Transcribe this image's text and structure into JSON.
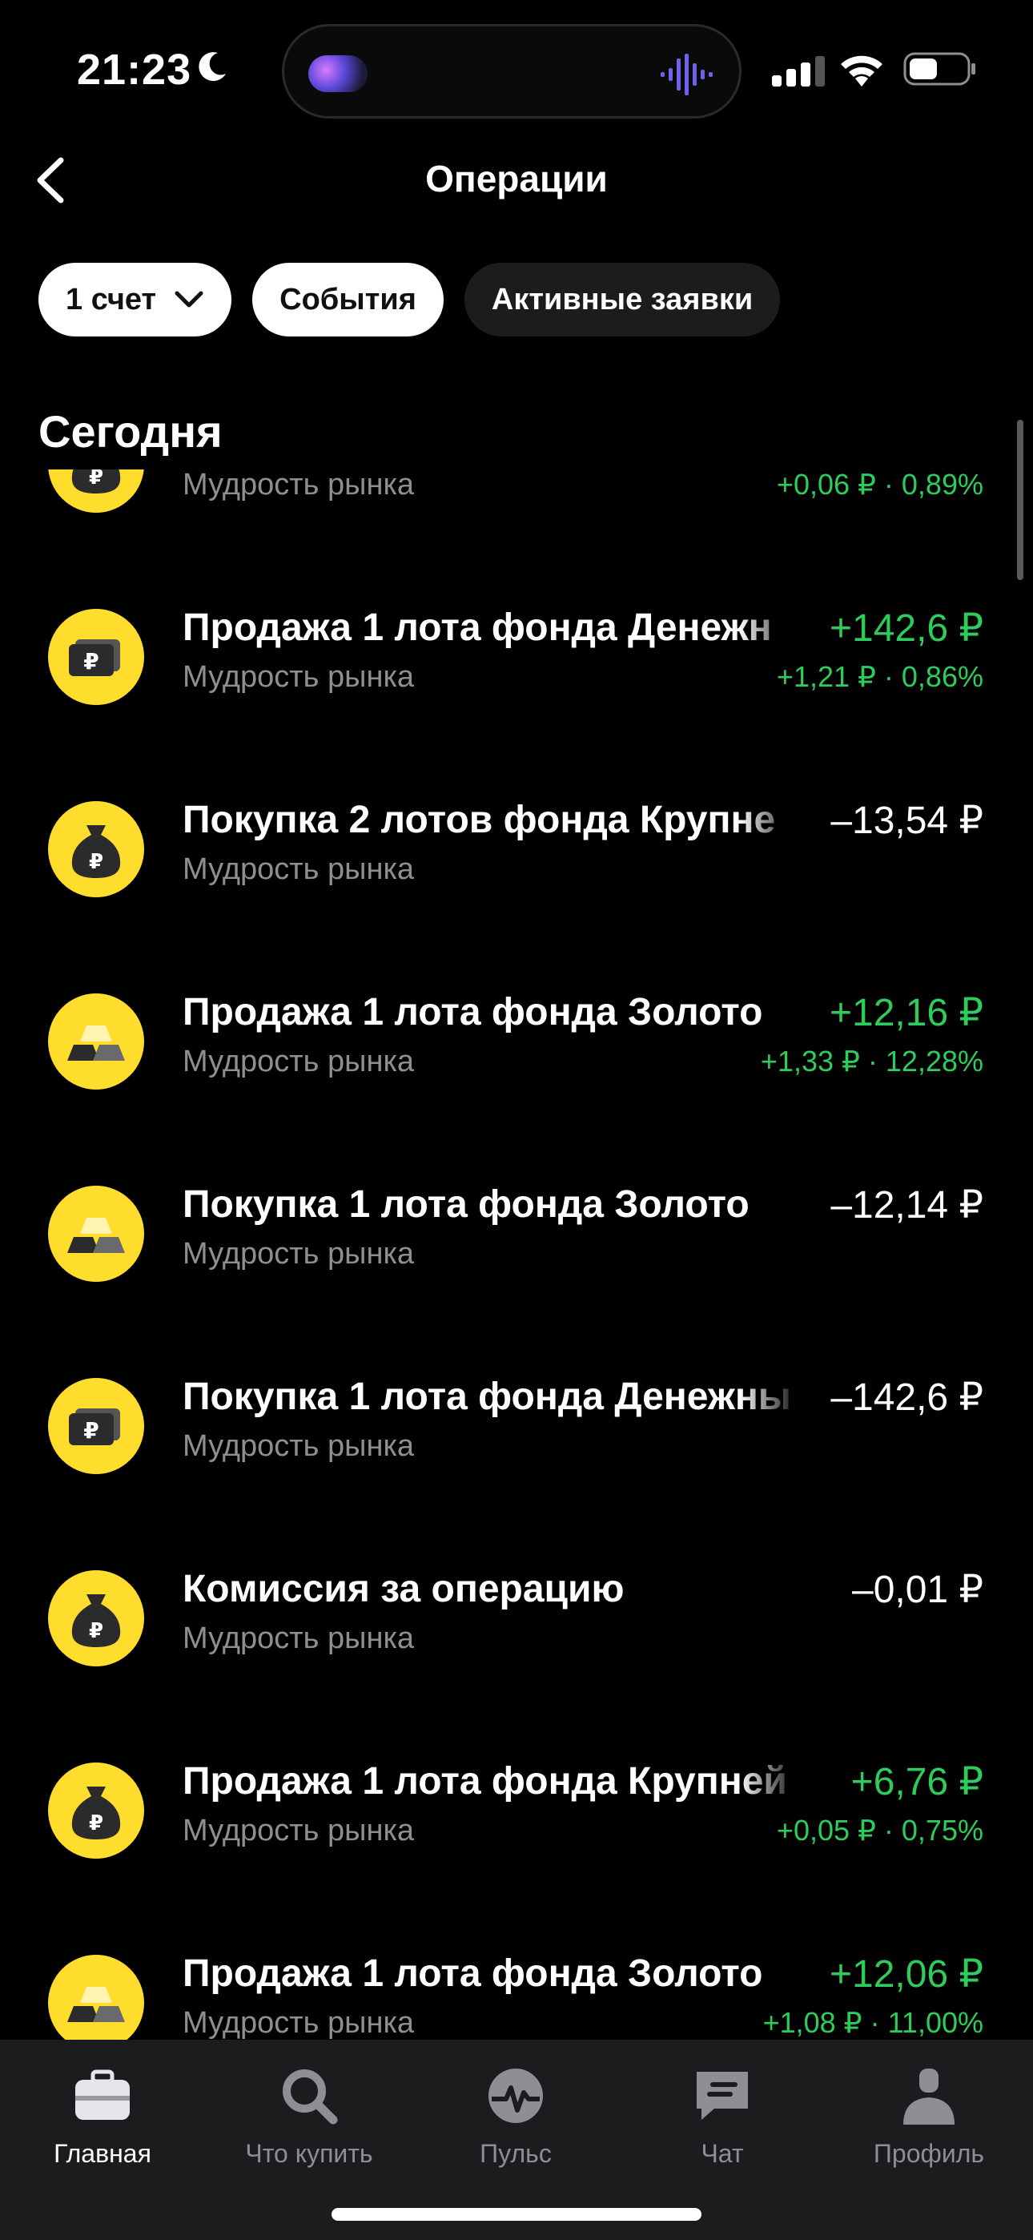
{
  "status": {
    "time": "21:23"
  },
  "header": {
    "title": "Операции"
  },
  "chips": [
    {
      "label": "1 счет"
    },
    {
      "label": "События"
    },
    {
      "label": "Активные заявки"
    }
  ],
  "section": {
    "title": "Сегодня"
  },
  "operations": [
    {
      "icon": "money-bag-icon",
      "title": "",
      "subtitle": "Мудрость рынка",
      "amount": "",
      "change": "+0,06 ₽ · 0,89%"
    },
    {
      "icon": "ruble-bills-icon",
      "title": "Продажа 1 лота фонда Денежн",
      "subtitle": "Мудрость рынка",
      "amount": "+142,6 ₽",
      "change": "+1,21 ₽ · 0,86%"
    },
    {
      "icon": "money-bag-icon",
      "title": "Покупка 2 лотов фонда Крупне",
      "subtitle": "Мудрость рынка",
      "amount": "–13,54 ₽",
      "change": ""
    },
    {
      "icon": "gold-bars-icon",
      "title": "Продажа 1 лота фонда Золото",
      "subtitle": "Мудрость рынка",
      "amount": "+12,16 ₽",
      "change": "+1,33 ₽ · 12,28%"
    },
    {
      "icon": "gold-bars-icon",
      "title": "Покупка 1 лота фонда Золото",
      "subtitle": "Мудрость рынка",
      "amount": "–12,14 ₽",
      "change": ""
    },
    {
      "icon": "ruble-bills-icon",
      "title": "Покупка 1 лота фонда Денежны",
      "subtitle": "Мудрость рынка",
      "amount": "–142,6 ₽",
      "change": ""
    },
    {
      "icon": "money-bag-icon",
      "title": "Комиссия за операцию",
      "subtitle": "Мудрость рынка",
      "amount": "–0,01 ₽",
      "change": ""
    },
    {
      "icon": "money-bag-icon",
      "title": "Продажа 1 лота фонда Крупней",
      "subtitle": "Мудрость рынка",
      "amount": "+6,76 ₽",
      "change": "+0,05 ₽ · 0,75%"
    },
    {
      "icon": "gold-bars-icon",
      "title": "Продажа 1 лота фонда Золото",
      "subtitle": "Мудрость рынка",
      "amount": "+12,06 ₽",
      "change": "+1,08 ₽ · 11,00%"
    }
  ],
  "tabs": [
    {
      "label": "Главная",
      "icon": "briefcase-icon"
    },
    {
      "label": "Что купить",
      "icon": "search-icon"
    },
    {
      "label": "Пульс",
      "icon": "pulse-icon"
    },
    {
      "label": "Чат",
      "icon": "chat-icon"
    },
    {
      "label": "Профиль",
      "icon": "profile-icon"
    }
  ],
  "colors": {
    "accent_yellow": "#ffdd2d",
    "positive_green": "#2ecc5c",
    "background": "#000000",
    "tabbar": "#1c1c1e"
  }
}
